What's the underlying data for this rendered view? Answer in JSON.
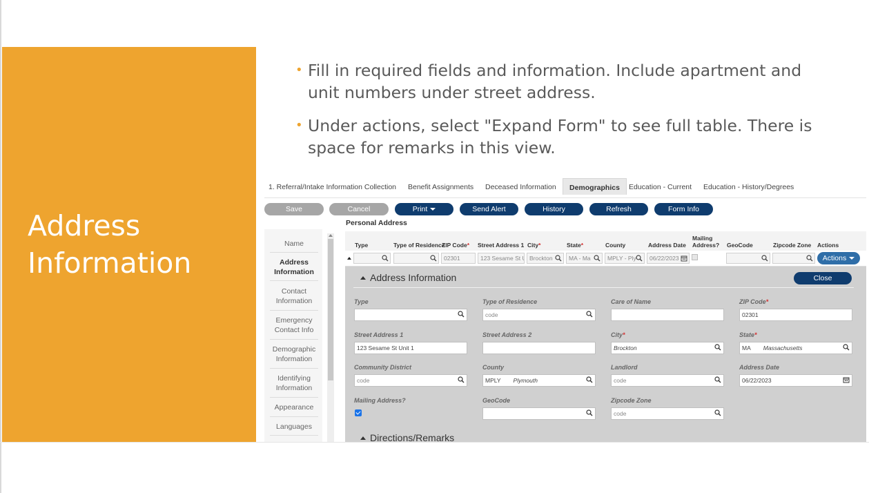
{
  "slide": {
    "title": "Address Information",
    "bullets": [
      "Fill in required fields and information. Include apartment and unit numbers under street address.",
      "Under actions, select \"Expand Form\" to see full table. There is space for remarks in this view."
    ]
  },
  "app": {
    "tabs": [
      {
        "label": "1. Referral/Intake Information Collection",
        "active": false
      },
      {
        "label": "Benefit Assignments",
        "active": false
      },
      {
        "label": "Deceased Information",
        "active": false
      },
      {
        "label": "Demographics",
        "active": true
      },
      {
        "label": "Education - Current",
        "active": false
      },
      {
        "label": "Education - History/Degrees",
        "active": false
      }
    ],
    "toolbar": {
      "save": "Save",
      "cancel": "Cancel",
      "print": "Print",
      "send_alert": "Send Alert",
      "history": "History",
      "refresh": "Refresh",
      "form_info": "Form Info"
    },
    "sidenav": [
      {
        "label": "Name",
        "active": false
      },
      {
        "label": "Address Information",
        "active": true
      },
      {
        "label": "Contact Information",
        "active": false
      },
      {
        "label": "Emergency Contact Info",
        "active": false
      },
      {
        "label": "Demographic Information",
        "active": false
      },
      {
        "label": "Identifying Information",
        "active": false
      },
      {
        "label": "Appearance",
        "active": false
      },
      {
        "label": "Languages",
        "active": false
      }
    ],
    "section_title": "Personal Address",
    "table": {
      "columns": {
        "type": "Type",
        "type_of_residence": "Type of Residence",
        "zip_code": "ZIP Code",
        "street_address_1": "Street Address 1",
        "city": "City",
        "state": "State",
        "county": "County",
        "address_date": "Address Date",
        "mailing_address": "Mailing Address?",
        "geocode": "GeoCode",
        "zipcode_zone": "Zipcode Zone",
        "actions": "Actions"
      },
      "required_marker": "*",
      "row": {
        "zip_code": "02301",
        "street_address_1": "123 Sesame St U",
        "city": "Brockton",
        "state": "MA - Ma",
        "county": "MPLY - Ply",
        "address_date": "06/22/2023"
      },
      "actions_button": "Actions"
    },
    "expanded": {
      "title": "Address Information",
      "close": "Close",
      "labels": {
        "type": "Type",
        "type_of_residence": "Type of Residence",
        "care_of_name": "Care of Name",
        "zip_code": "ZIP Code",
        "street_address_1": "Street Address 1",
        "street_address_2": "Street Address 2",
        "city": "City",
        "state": "State",
        "community_district": "Community District",
        "county": "County",
        "landlord": "Landlord",
        "address_date": "Address Date",
        "mailing_address": "Mailing Address?",
        "geocode": "GeoCode",
        "zipcode_zone": "Zipcode Zone"
      },
      "values": {
        "type_of_residence_ph": "code",
        "zip_code": "02301",
        "street_address_1": "123 Sesame St Unit 1",
        "city": "Brockton",
        "state_code": "MA",
        "state_name": "Massachusetts",
        "community_district_ph": "code",
        "county_code": "MPLY",
        "county_name": "Plymouth",
        "landlord_ph": "code",
        "address_date": "06/22/2023",
        "zipcode_zone_ph": "code"
      },
      "mailing_checked": true,
      "directions_title": "Directions/Remarks"
    },
    "colors": {
      "accent_orange": "#eea42f",
      "navy_button": "#0f3c6e",
      "actions_blue": "#2f6ea8",
      "gray_button": "#a6a6a6"
    }
  }
}
